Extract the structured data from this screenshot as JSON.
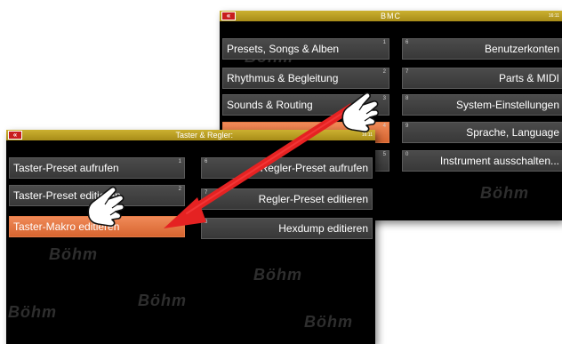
{
  "back_window": {
    "title": "BMC",
    "back_symbol": "«",
    "clock": "16:11",
    "left_buttons": [
      {
        "num": "1",
        "label": "Presets, Songs & Alben"
      },
      {
        "num": "2",
        "label": "Rhythmus & Begleitung"
      },
      {
        "num": "3",
        "label": "Sounds & Routing"
      },
      {
        "num": "4",
        "label": ""
      },
      {
        "num": "5",
        "label": ""
      }
    ],
    "right_buttons": [
      {
        "num": "6",
        "label": "Benutzerkonten"
      },
      {
        "num": "7",
        "label": "Parts & MIDI"
      },
      {
        "num": "8",
        "label": "System-Einstellungen"
      },
      {
        "num": "9",
        "label": "Sprache, Language"
      },
      {
        "num": "0",
        "label": "Instrument ausschalten..."
      }
    ],
    "watermarks": [
      "Böhm",
      "Böhm"
    ]
  },
  "front_window": {
    "title": "Taster & Regler:",
    "back_symbol": "«",
    "clock": "16:11",
    "left_buttons": [
      {
        "num": "1",
        "label": "Taster-Preset aufrufen"
      },
      {
        "num": "2",
        "label": "Taster-Preset editieren"
      },
      {
        "num": "3",
        "label": "Taster-Makro editieren"
      }
    ],
    "right_buttons": [
      {
        "num": "6",
        "label": "Regler-Preset aufrufen"
      },
      {
        "num": "7",
        "label": "Regler-Preset editieren"
      },
      {
        "num": "8",
        "label": "Hexdump editieren"
      }
    ],
    "watermarks": [
      "Böhm",
      "Böhm",
      "Böhm",
      "Böhm",
      "Böhm"
    ]
  },
  "colors": {
    "titlebar": "#b89c20",
    "active_button": "#e07040",
    "arrow": "#e52222",
    "back_button": "#c81e1e"
  },
  "icons": [
    "pointing-hand-icon",
    "red-arrow-icon",
    "back-icon"
  ]
}
